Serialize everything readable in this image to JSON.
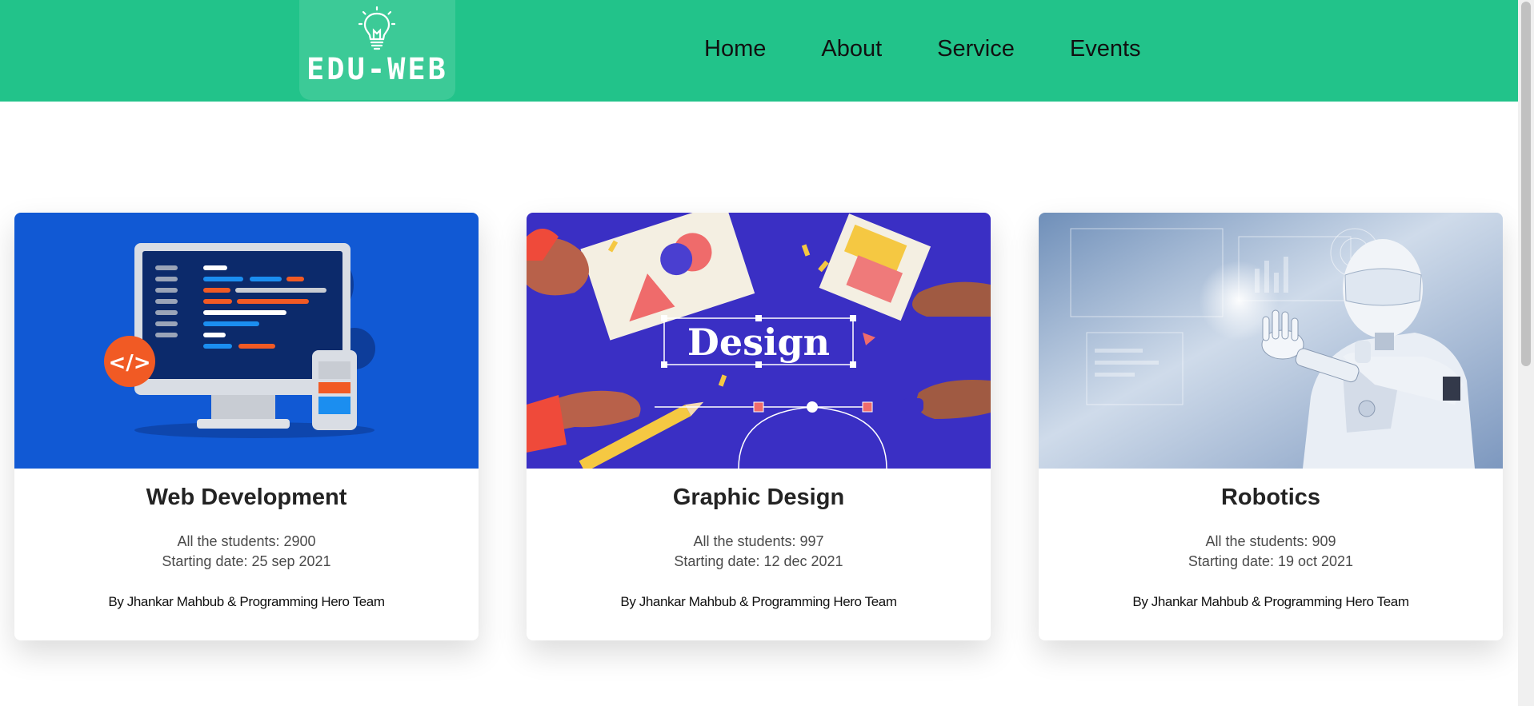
{
  "logo": {
    "text": "EDU-WEB"
  },
  "nav": {
    "items": [
      {
        "label": "Home"
      },
      {
        "label": "About"
      },
      {
        "label": "Service"
      },
      {
        "label": "Events"
      }
    ]
  },
  "courses": [
    {
      "title": "Web Development",
      "students": "All the students: 2900",
      "start": "Starting date: 25 sep 2021",
      "by": "By Jhankar Mahbub & Programming Hero Team",
      "image_word": ""
    },
    {
      "title": "Graphic Design",
      "students": "All the students: 997",
      "start": "Starting date: 12 dec 2021",
      "by": "By Jhankar Mahbub & Programming Hero Team",
      "image_word": "Design"
    },
    {
      "title": "Robotics",
      "students": "All the students: 909",
      "start": "Starting date: 19 oct 2021",
      "by": "By Jhankar Mahbub & Programming Hero Team",
      "image_word": ""
    }
  ],
  "colors": {
    "navbar": "#22c38a",
    "web_dev_bg": "#1159d4",
    "design_bg": "#3a2fc4",
    "robotics_bg": "#b9cde6"
  },
  "icons": [
    "lightbulb-icon",
    "code-icon"
  ]
}
